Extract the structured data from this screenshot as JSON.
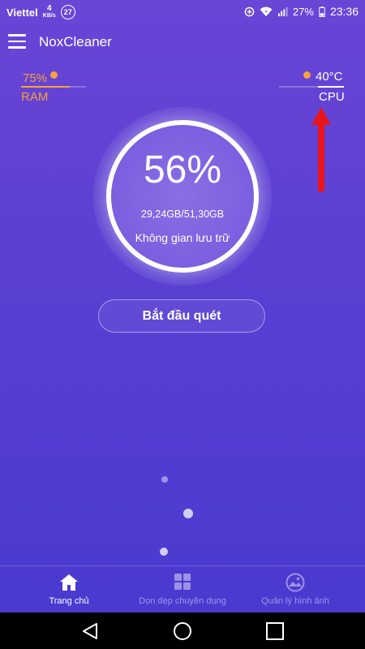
{
  "status_bar": {
    "carrier": "Viettel",
    "speed_value": "4",
    "speed_unit": "KB/s",
    "notification_count": "27",
    "battery": "27%",
    "time": "23:36"
  },
  "app_bar": {
    "title": "NoxCleaner"
  },
  "ram": {
    "percent": "75%",
    "label": "RAM",
    "level": 0.75
  },
  "cpu": {
    "temperature": "40°C",
    "label": "CPU"
  },
  "storage": {
    "percent": "56%",
    "usage": "29,24GB/51,30GB",
    "label": "Không gian lưu trữ"
  },
  "scan_button": {
    "label": "Bắt đầu quét"
  },
  "bottom_nav": {
    "items": [
      {
        "label": "Trang chủ",
        "icon": "home-icon",
        "active": true
      },
      {
        "label": "Dọn dẹp chuyên dụng",
        "icon": "grid-icon",
        "active": false
      },
      {
        "label": "Quản lý hình ảnh",
        "icon": "image-icon",
        "active": false
      }
    ]
  },
  "colors": {
    "accent": "#f6a23a",
    "background_top": "#6a45d6",
    "background_bottom": "#4a3ad0",
    "arrow": "#e8151b"
  }
}
